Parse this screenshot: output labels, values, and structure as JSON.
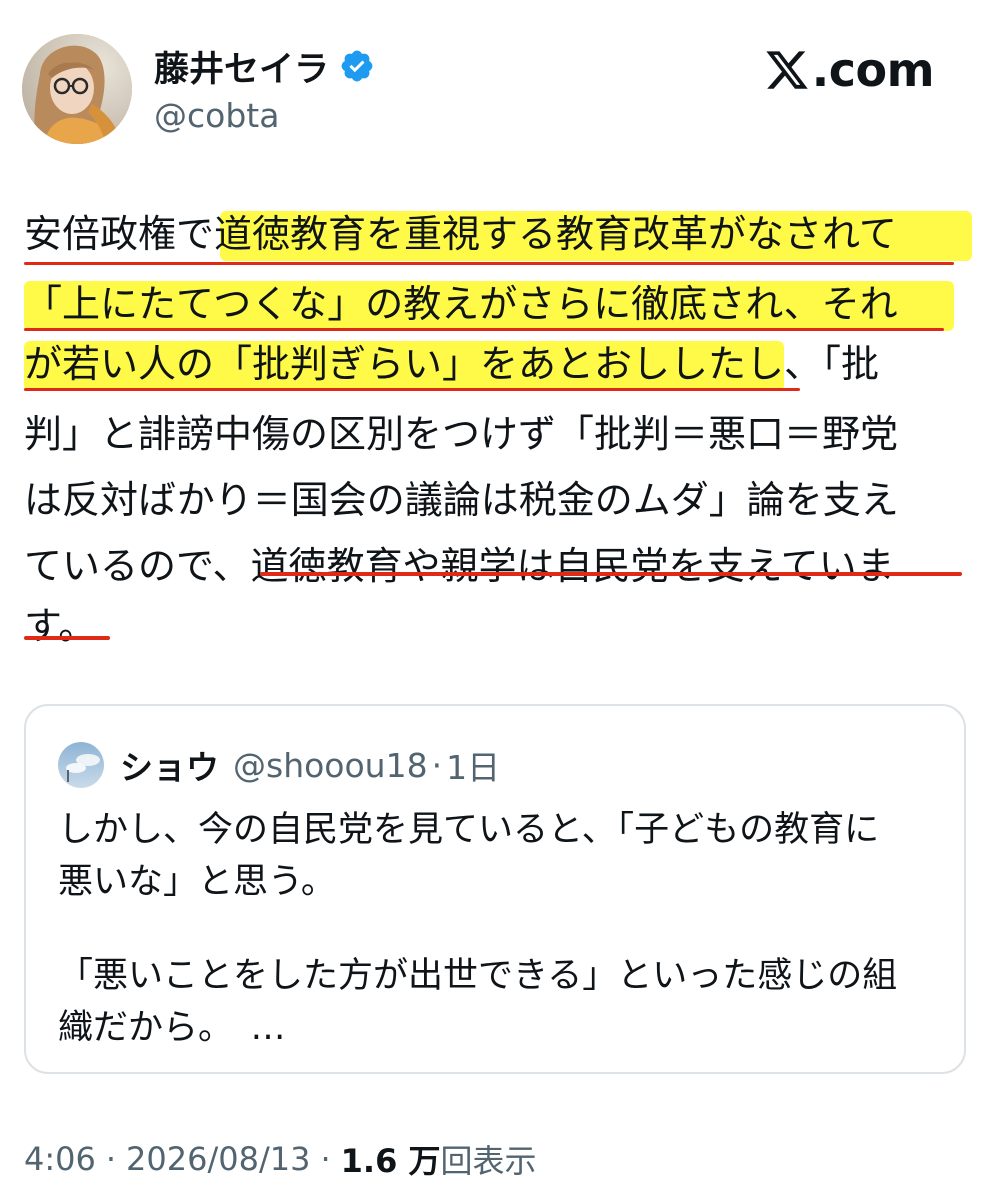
{
  "header": {
    "display_name": "藤井セイラ",
    "handle": "@cobta",
    "brand_text": ".com",
    "avatar_icon": "user-avatar-photo",
    "verified_icon": "verified-badge-icon",
    "brand_icon": "x-logo-icon"
  },
  "tweet": {
    "lines": [
      [
        "安倍政権で",
        "道徳教育を重視する教育改革がなされて"
      ],
      [
        "「上にたてつくな」の教えがさらに徹底され、それ"
      ],
      [
        "が若い人の「批判ぎらい」をあとおしした",
        "し、「批"
      ],
      [
        "判」と誹謗中傷の区別をつけず「批判＝悪口＝野党"
      ],
      [
        "は反対ばかり＝国会の議論は税金のムダ」論を支え"
      ],
      [
        "ているので、",
        "道徳教育や親学は自民党を支えていま"
      ],
      [
        "す。"
      ]
    ],
    "highlight_color": "#fff838",
    "underline_color": "#e02a18"
  },
  "quote": {
    "name": "ショウ",
    "handle": "@shooou18",
    "dot": "·",
    "time": "1日",
    "text_lines": [
      "しかし、今の自民党を見ていると、「子どもの教育に",
      "悪いな」と思う。",
      "「悪いことをした方が出世できる」といった感じの組",
      "織だから。　…"
    ]
  },
  "footer": {
    "time": "4:06",
    "sep1": "·",
    "date": "2026/08/13",
    "sep2": "·",
    "views_count": "1.6 万",
    "views_label": "回表示"
  },
  "colors": {
    "text": "#0f1419",
    "secondary": "#536471",
    "verified": "#1d9bf0",
    "border": "#dde2e6"
  }
}
